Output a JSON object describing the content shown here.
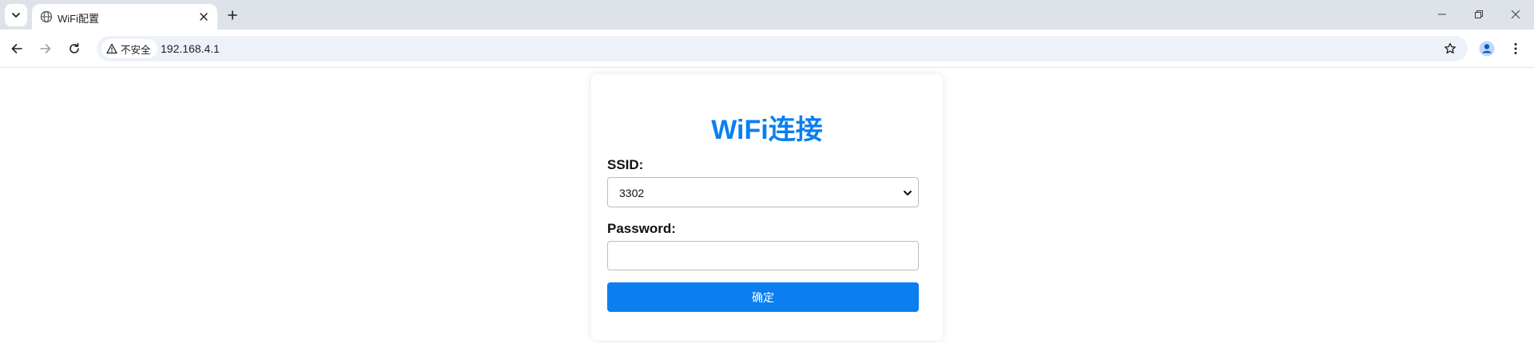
{
  "browser": {
    "tab": {
      "title": "WiFi配置"
    },
    "address_bar": {
      "security_label": "不安全",
      "url": "192.168.4.1"
    },
    "icons": {
      "tab_search": "chevron-down-icon",
      "favicon": "globe-icon",
      "tab_close": "close-icon",
      "new_tab": "plus-icon",
      "minimize": "minimize-icon",
      "restore": "restore-icon",
      "close_window": "close-icon",
      "back": "arrow-left-icon",
      "forward": "arrow-right-icon",
      "reload": "reload-icon",
      "warning": "warning-icon",
      "bookmark": "star-icon",
      "profile": "profile-icon",
      "menu": "kebab-menu-icon"
    }
  },
  "page": {
    "title": "WiFi连接",
    "ssid_label": "SSID:",
    "ssid_value": "3302",
    "password_label": "Password:",
    "password_value": "",
    "submit_label": "确定"
  },
  "colors": {
    "accent": "#0b7ff0",
    "tabstrip_bg": "#dee3ea",
    "omnibox_bg": "#edf1f8"
  }
}
